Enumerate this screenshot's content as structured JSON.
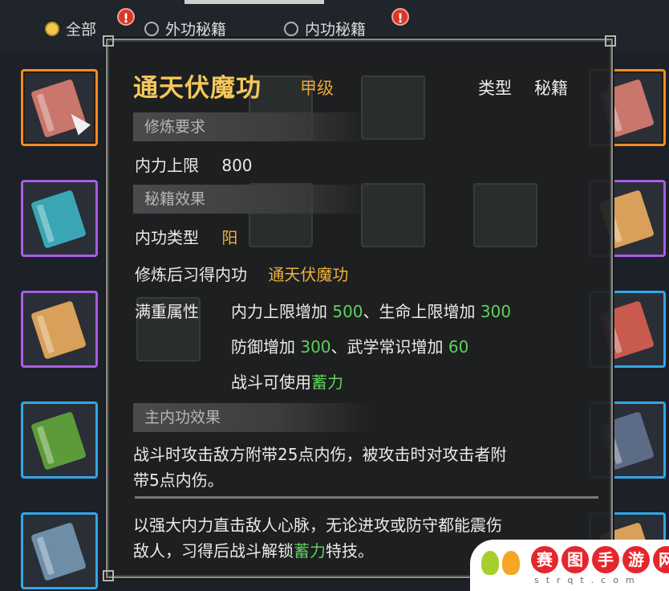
{
  "filters": [
    {
      "label": "全部",
      "state": "selected",
      "badge": "!"
    },
    {
      "label": "外功秘籍",
      "state": "unselected",
      "badge": ""
    },
    {
      "label": "内功秘籍",
      "state": "unselected",
      "badge": "!"
    }
  ],
  "inventory_icons": [
    "book-icon"
  ],
  "tooltip": {
    "name": "通天伏魔功",
    "grade": "甲级",
    "type_label": "类型",
    "type_value": "秘籍",
    "requirements_header": "修炼要求",
    "requirement_label": "内力上限",
    "requirement_value": "800",
    "effects_header": "秘籍效果",
    "neigong_type_label": "内功类型",
    "neigong_type_value": "阳",
    "learn_label": "修炼后习得内功",
    "learn_value": "通天伏魔功",
    "full_attr_label": "满重属性",
    "attr_line1_a": "内力上限增加",
    "attr_line1_a_val": "500",
    "attr_line1_sep": "、生命上限增加",
    "attr_line1_b_val": "300",
    "attr_line2_a": "防御增加",
    "attr_line2_a_val": "300",
    "attr_line2_sep": "、武学常识增加",
    "attr_line2_b_val": "60",
    "attr_line3_a": "战斗可使用",
    "attr_line3_skill": "蓄力",
    "main_effect_header": "主内功效果",
    "main_effect_text_1": "战斗时攻击敌方附带25点内伤，被攻击时对攻击者附",
    "main_effect_text_2": "带5点内伤。",
    "desc_1": "以强大内力直击敌人心脉，无论进攻或防守都能震伤",
    "desc_2a": "敌人，习得后战斗解锁",
    "desc_2_skill": "蓄力",
    "desc_2b": "特技。"
  },
  "watermark": {
    "chars": [
      "赛",
      "图",
      "手",
      "游",
      "网"
    ],
    "url": "strqt.com"
  },
  "colors": {
    "title": "#f4c75a",
    "grade": "#e9a733",
    "highlight_gold": "#f0b23a",
    "highlight_green": "#5fd15a",
    "slot_orange": "#f08c2a",
    "slot_purple": "#a85de3",
    "slot_blue": "#33a7e8"
  }
}
